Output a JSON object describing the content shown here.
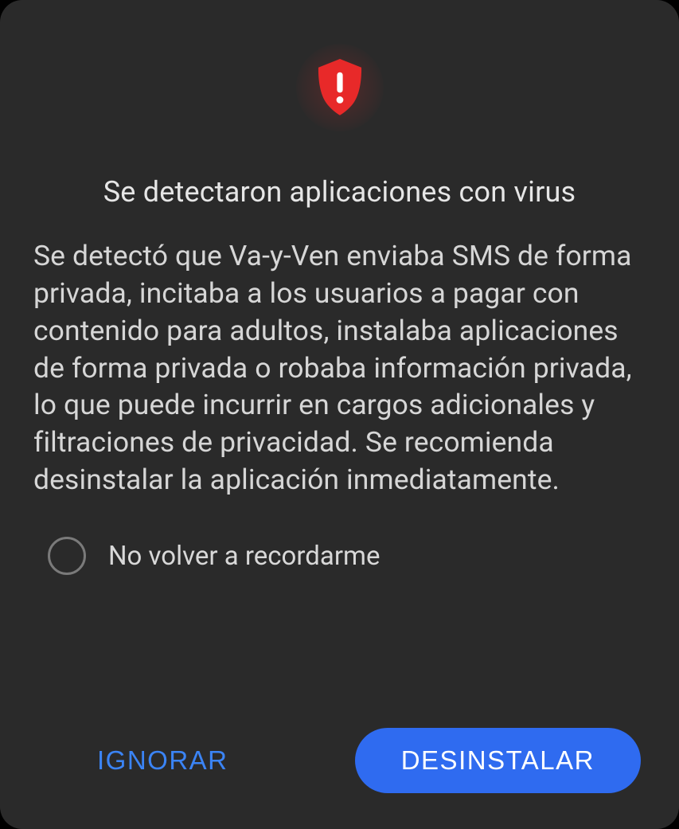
{
  "dialog": {
    "title": "Se detectaron aplicaciones con virus",
    "body": "Se detectó que Va-y-Ven enviaba SMS de forma privada, incitaba a los usuarios a pagar con contenido para adultos, instalaba aplicaciones de forma privada o robaba información privada, lo que puede incurrir en cargos adicionales y filtraciones de privacidad. Se recomienda desinstalar la aplicación inmediatamente.",
    "checkbox_label": "No volver a recordarme",
    "ignore_label": "IGNORAR",
    "uninstall_label": "DESINSTALAR",
    "icon": "shield-alert-icon",
    "colors": {
      "accent": "#2f6bf0",
      "danger": "#e82929",
      "background": "#2a2a2a",
      "text_primary": "#e6e6e6",
      "text_secondary": "#d6d6d6"
    }
  }
}
